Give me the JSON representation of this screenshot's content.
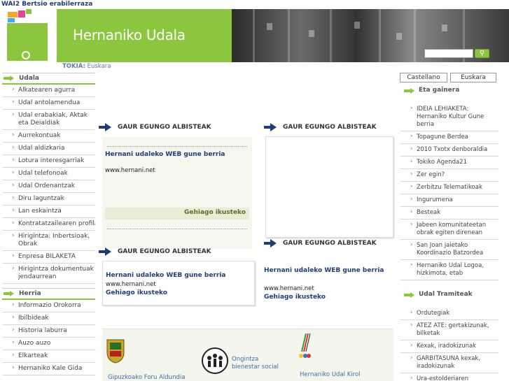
{
  "wai_text": "WAI2 Bertsio erabilerraza",
  "site_title": "Hernaniko Udala",
  "brand_colors": {
    "green": "#8cc63f",
    "navy": "#1f3c7a"
  },
  "search": {
    "button_icon": "search-icon",
    "value": "",
    "placeholder": ""
  },
  "location": {
    "label": "TOKIA:",
    "value": "Euskara"
  },
  "languages": [
    "Castellano",
    "Euskara"
  ],
  "left_sections": [
    {
      "title": "Udala",
      "items": [
        "Alkatearen agurra",
        "Udal antolamendua",
        "Udal erabakiak, Aktak eta Deialdiak",
        "Aurrekontuak",
        "Udal aldizkaria",
        "Lotura interesgarriak",
        "Udal telefonoak",
        "Udal Ordenantzak",
        "Diru laguntzak",
        "Lan eskaintza",
        "Kontratatzailearen profila",
        "Hirigintza: Inbertsioak, Obrak",
        "Enpresa BILAKETA",
        "Hirigintza dokumentuak jendaurrean"
      ]
    },
    {
      "title": "Herria",
      "items": [
        "Informazio Orokorra",
        "Ibilbideak",
        "Historia laburra",
        "Auzo auzo",
        "Elkarteak",
        "Hernaniko Kale Gida"
      ]
    }
  ],
  "news_blocks": [
    {
      "heading": "GAUR EGUNGO ALBISTEAK",
      "title": "Hernani udaleko WEB gune berria",
      "url": "www.hernani.net",
      "more": "Gehiago ikusteko"
    },
    {
      "heading": "GAUR EGUNGO ALBISTEAK",
      "title": "",
      "url": "",
      "more": ""
    },
    {
      "heading": "GAUR EGUNGO ALBISTEAK",
      "title": "Hernani udaleko WEB gune berria",
      "url": "www.hernani.net",
      "more": "Gehiago ikusteko"
    },
    {
      "heading": "GAUR EGUNGO ALBISTEAK",
      "title": "Hernani udaleko WEB gune berria",
      "url": "www.hernani.net",
      "more": "Gehiago ikusteko"
    }
  ],
  "right_sections": [
    {
      "title": "Eta gainera",
      "items": [
        "IDEIA LEHIAKETA: Hernaniko Kultur Gune berria",
        "Topagune Berdea",
        "2010 Txotx denboraldia",
        "Tokiko Agenda21",
        "Zer egin?",
        "Zerbitzu Telematikoak",
        "Ingurumena",
        "Besteak",
        "Jabeen komunitateetan obrak egiten direnean",
        "San Joan jaietako Koordinazio Batzordea",
        "Hernaniko Udal Logoa, hizkimota, etab"
      ]
    },
    {
      "title": "Udal Tramiteak",
      "items": [
        "Ordutegiak",
        "ATEZ ATE: gertakizunak, bilketak",
        "Kexak, iradokizunak",
        "GARBITASUNA kexak, iradokizunak",
        "Ura-estolderiaren erreziboa kontsulta"
      ]
    }
  ],
  "partner_logos": [
    {
      "caption": "Gipuzkoako Foru Aldundia",
      "icon": "shield-icon"
    },
    {
      "caption": "Ongintza bienestar social",
      "icon": "people-circle-icon"
    },
    {
      "caption": "Hernaniko Udal Kirol",
      "icon": "sport-icon"
    }
  ]
}
